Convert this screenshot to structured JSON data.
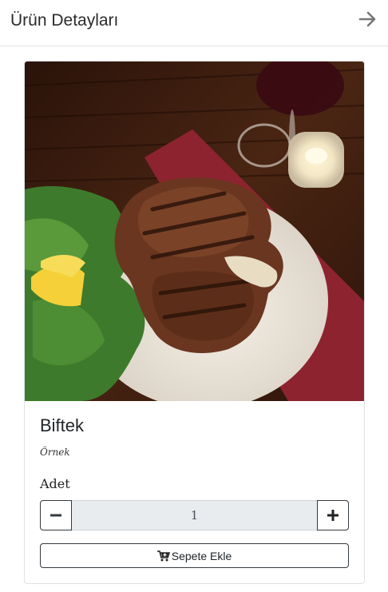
{
  "header": {
    "title": "Ürün Detayları",
    "close_icon": "arrow-right-icon"
  },
  "product": {
    "name": "Biftek",
    "description": "Örnek",
    "image_icon": "steak-photo"
  },
  "quantity": {
    "label": "Adet",
    "value": "1",
    "minus_icon": "minus-icon",
    "plus_icon": "plus-icon"
  },
  "cart_button": {
    "label": "Sepete Ekle",
    "icon": "cart-plus-icon"
  },
  "colors": {
    "border": "#dee2e6",
    "dark": "#343a40",
    "input_bg": "#e9ecef"
  }
}
